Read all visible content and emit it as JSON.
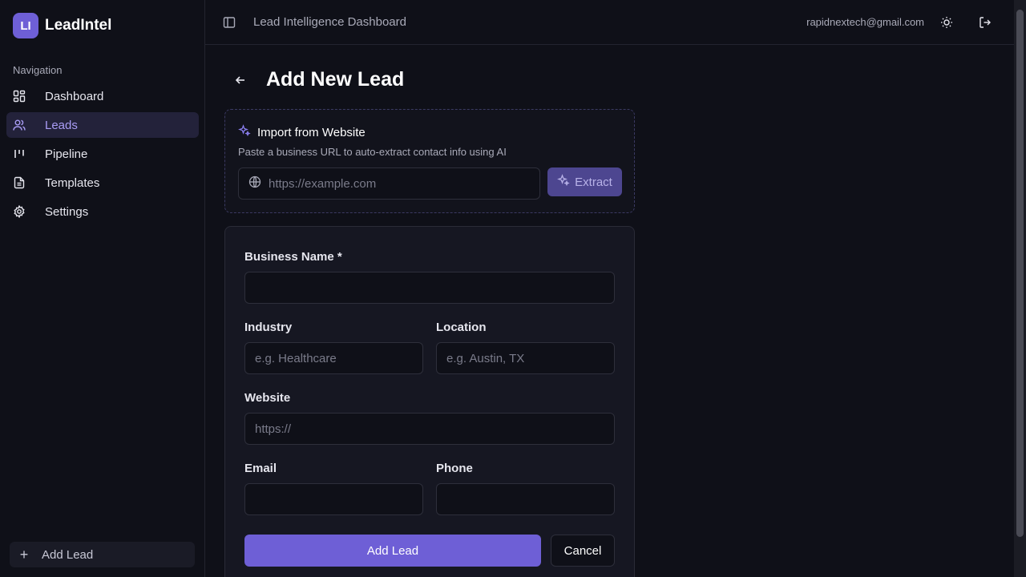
{
  "app": {
    "logo_initials": "LI",
    "name": "LeadIntel",
    "accent_color": "#6e5fd6"
  },
  "sidebar": {
    "heading": "Navigation",
    "items": [
      {
        "label": "Dashboard",
        "icon": "grid-icon",
        "active": false
      },
      {
        "label": "Leads",
        "icon": "users-icon",
        "active": true
      },
      {
        "label": "Pipeline",
        "icon": "kanban-icon",
        "active": false
      },
      {
        "label": "Templates",
        "icon": "document-icon",
        "active": false
      },
      {
        "label": "Settings",
        "icon": "gear-icon",
        "active": false
      }
    ],
    "add_lead_label": "Add Lead"
  },
  "topbar": {
    "title": "Lead Intelligence Dashboard",
    "user_email": "rapidnextech@gmail.com"
  },
  "page": {
    "title": "Add New Lead"
  },
  "import": {
    "title": "Import from Website",
    "description": "Paste a business URL to auto-extract contact info using AI",
    "url_placeholder": "https://example.com",
    "extract_label": "Extract"
  },
  "form": {
    "business_name_label": "Business Name *",
    "business_name_value": "",
    "industry_label": "Industry",
    "industry_placeholder": "e.g. Healthcare",
    "location_label": "Location",
    "location_placeholder": "e.g. Austin, TX",
    "website_label": "Website",
    "website_placeholder": "https://",
    "email_label": "Email",
    "phone_label": "Phone",
    "submit_label": "Add Lead",
    "cancel_label": "Cancel"
  }
}
